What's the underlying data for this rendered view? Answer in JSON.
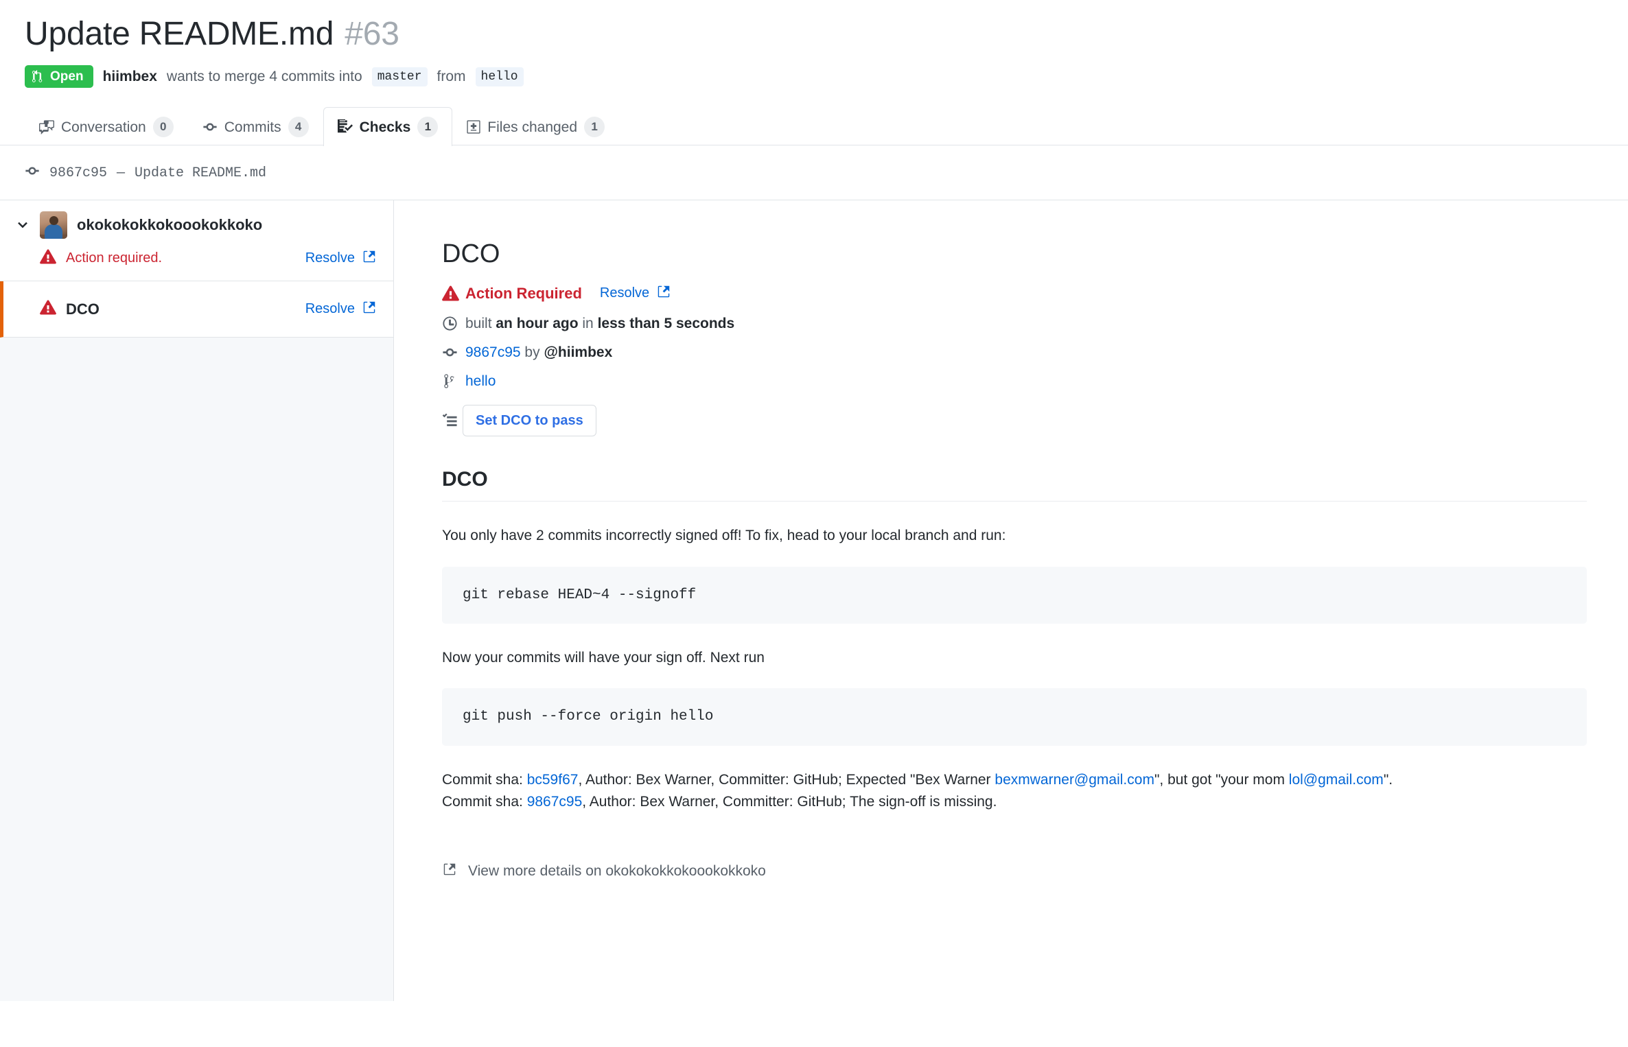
{
  "header": {
    "title": "Update README.md",
    "number": "#63",
    "state": "Open",
    "author": "hiimbex",
    "merge_text_1": "wants to merge 4 commits into",
    "base_branch": "master",
    "merge_text_2": "from",
    "head_branch": "hello"
  },
  "tabs": [
    {
      "label": "Conversation",
      "count": "0",
      "icon": "comment-discussion-icon",
      "selected": false
    },
    {
      "label": "Commits",
      "count": "4",
      "icon": "git-commit-icon",
      "selected": false
    },
    {
      "label": "Checks",
      "count": "1",
      "icon": "checklist-icon",
      "selected": true
    },
    {
      "label": "Files changed",
      "count": "1",
      "icon": "file-diff-icon",
      "selected": false
    }
  ],
  "commit_bar": {
    "icon": "git-commit-icon",
    "sha": "9867c95",
    "dash": "—",
    "message": "Update README.md"
  },
  "sidebar": {
    "group": {
      "app_name": "okokokokkokoookokkoko",
      "chevron": "chevron-down-icon",
      "avatar": "avatar",
      "status_icon": "alert-icon",
      "status_text": "Action required.",
      "resolve_label": "Resolve",
      "resolve_icon": "link-external-icon"
    },
    "items": [
      {
        "name": "DCO",
        "status_icon": "alert-icon",
        "resolve_label": "Resolve",
        "resolve_icon": "link-external-icon",
        "selected": true
      }
    ]
  },
  "main": {
    "title": "DCO",
    "status": {
      "icon": "alert-icon",
      "label": "Action Required",
      "resolve_label": "Resolve",
      "resolve_icon": "link-external-icon"
    },
    "built": {
      "icon": "clock-icon",
      "prefix": "built",
      "when": "an hour ago",
      "middle": "in",
      "duration": "less than 5 seconds"
    },
    "commit": {
      "icon": "git-commit-icon",
      "sha": "9867c95",
      "by": "by",
      "user": "@hiimbex"
    },
    "branch": {
      "icon": "git-branch-icon",
      "name": "hello"
    },
    "action": {
      "icon": "checklist-icon",
      "button_label": "Set DCO to pass"
    },
    "section_title": "DCO",
    "paragraph_1": "You only have 2 commits incorrectly signed off! To fix, head to your local branch and run:",
    "code_1": "git rebase HEAD~4 --signoff",
    "paragraph_2": "Now your commits will have your sign off. Next run",
    "code_2": "git push --force origin hello",
    "commit_report": {
      "line1_a": "Commit sha: ",
      "line1_sha": "bc59f67",
      "line1_b": ", Author: Bex Warner, Committer: GitHub; Expected \"Bex Warner ",
      "line1_email": "bexmwarner@gmail.com",
      "line1_c": "\", but got \"your mom ",
      "line1_email2": "lol@gmail.com",
      "line1_d": "\".",
      "line2_a": "Commit sha: ",
      "line2_sha": "9867c95",
      "line2_b": ", Author: Bex Warner, Committer: GitHub; The sign-off is missing."
    },
    "footer": {
      "icon": "link-external-icon",
      "label": "View more details on okokokokkokoookokkoko"
    }
  },
  "colors": {
    "open_green": "#2cbe4e",
    "danger_red": "#cb2431",
    "link_blue": "#0366d6",
    "selected_orange": "#e36209",
    "border_gray": "#e1e4e8",
    "muted_gray": "#586069"
  }
}
